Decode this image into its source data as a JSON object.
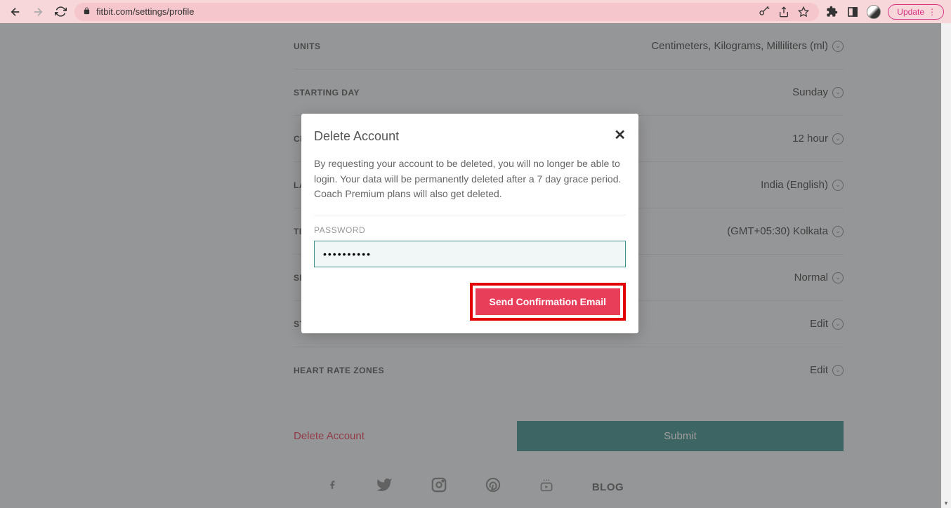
{
  "browser": {
    "url": "fitbit.com/settings/profile",
    "update_label": "Update"
  },
  "settings": {
    "rows": [
      {
        "label": "UNITS",
        "value": "Centimeters, Kilograms, Milliliters (ml)"
      },
      {
        "label": "STARTING DAY",
        "value": "Sunday"
      },
      {
        "label": "CLOCK",
        "value": "12 hour"
      },
      {
        "label": "LANGUAGE",
        "value": "India (English)"
      },
      {
        "label": "TIMEZONE",
        "value": "(GMT+05:30) Kolkata"
      },
      {
        "label": "SLEEP",
        "value": "Normal"
      },
      {
        "label": "STRIDE LENGTH",
        "value": "Edit"
      },
      {
        "label": "HEART RATE ZONES",
        "value": "Edit"
      }
    ],
    "delete_link": "Delete Account",
    "submit_label": "Submit"
  },
  "footer": {
    "blog": "BLOG"
  },
  "modal": {
    "title": "Delete Account",
    "text": "By requesting your account to be deleted, you will no longer be able to login. Your data will be permanently deleted after a 7 day grace period. Coach Premium plans will also get deleted.",
    "password_label": "PASSWORD",
    "password_value": "••••••••••",
    "send_label": "Send Confirmation Email"
  }
}
